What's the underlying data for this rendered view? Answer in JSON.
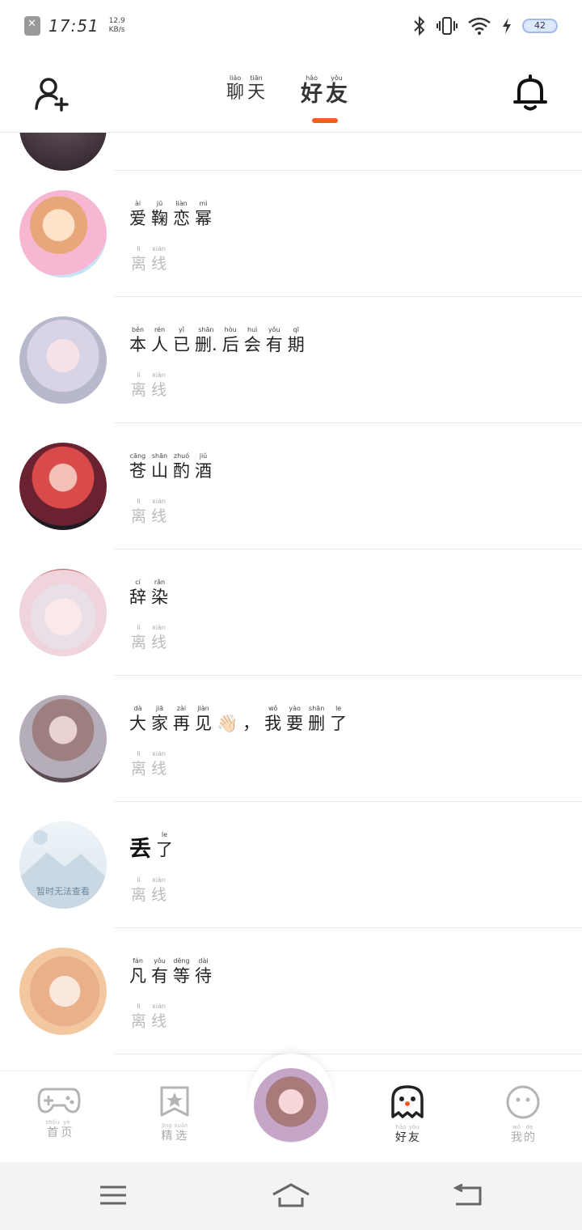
{
  "status_bar": {
    "time": "17:51",
    "speed_value": "12.9",
    "speed_unit": "KB/s",
    "battery": "42"
  },
  "header": {
    "tabs": [
      {
        "label": "聊天",
        "chars": [
          {
            "py": "liáo",
            "hz": "聊"
          },
          {
            "py": "tiān",
            "hz": "天"
          }
        ],
        "active": false
      },
      {
        "label": "好友",
        "chars": [
          {
            "py": "hǎo",
            "hz": "好"
          },
          {
            "py": "yǒu",
            "hz": "友"
          }
        ],
        "active": true
      }
    ]
  },
  "friends": [
    {
      "name_chars": [
        {
          "py": "ài",
          "hz": "爱"
        },
        {
          "py": "jū",
          "hz": "鞠"
        },
        {
          "py": "liàn",
          "hz": "恋"
        },
        {
          "py": "mì",
          "hz": "幂"
        }
      ],
      "status": {
        "chars": [
          {
            "py": "lí",
            "hz": "离"
          },
          {
            "py": "xiàn",
            "hz": "线"
          }
        ]
      }
    },
    {
      "name_chars": [
        {
          "py": "běn",
          "hz": "本"
        },
        {
          "py": "rén",
          "hz": "人"
        },
        {
          "py": "yǐ",
          "hz": "已"
        },
        {
          "py": "shān",
          "hz": "删."
        },
        {
          "py": "hòu",
          "hz": "后"
        },
        {
          "py": "huì",
          "hz": "会"
        },
        {
          "py": "yǒu",
          "hz": "有"
        },
        {
          "py": "qī",
          "hz": "期"
        }
      ],
      "status": {
        "chars": [
          {
            "py": "lí",
            "hz": "离"
          },
          {
            "py": "xiàn",
            "hz": "线"
          }
        ]
      }
    },
    {
      "name_chars": [
        {
          "py": "cāng",
          "hz": "苍"
        },
        {
          "py": "shān",
          "hz": "山"
        },
        {
          "py": "zhuó",
          "hz": "酌"
        },
        {
          "py": "jiǔ",
          "hz": "酒"
        }
      ],
      "status": {
        "chars": [
          {
            "py": "lí",
            "hz": "离"
          },
          {
            "py": "xiàn",
            "hz": "线"
          }
        ]
      }
    },
    {
      "name_chars": [
        {
          "py": "cí",
          "hz": "辞"
        },
        {
          "py": "rǎn",
          "hz": "染"
        }
      ],
      "status": {
        "chars": [
          {
            "py": "lí",
            "hz": "离"
          },
          {
            "py": "xiàn",
            "hz": "线"
          }
        ]
      }
    },
    {
      "name_chars": [
        {
          "py": "dà",
          "hz": "大"
        },
        {
          "py": "jiā",
          "hz": "家"
        },
        {
          "py": "zài",
          "hz": "再"
        },
        {
          "py": "jiàn",
          "hz": "见"
        },
        {
          "py": "",
          "hz": "👋🏻"
        },
        {
          "py": "",
          "hz": "，"
        },
        {
          "py": "wǒ",
          "hz": "我"
        },
        {
          "py": "yào",
          "hz": "要"
        },
        {
          "py": "shān",
          "hz": "删"
        },
        {
          "py": "le",
          "hz": "了"
        }
      ],
      "status": {
        "chars": [
          {
            "py": "lí",
            "hz": "离"
          },
          {
            "py": "xiàn",
            "hz": "线"
          }
        ]
      }
    },
    {
      "name_chars": [
        {
          "py": "",
          "hz": "丢"
        },
        {
          "py": "le",
          "hz": "了"
        }
      ],
      "status": {
        "chars": [
          {
            "py": "lí",
            "hz": "离"
          },
          {
            "py": "xiàn",
            "hz": "线"
          }
        ]
      },
      "avatar_text": "暂时无法查看"
    },
    {
      "name_chars": [
        {
          "py": "fán",
          "hz": "凡"
        },
        {
          "py": "yǒu",
          "hz": "有"
        },
        {
          "py": "děng",
          "hz": "等"
        },
        {
          "py": "dài",
          "hz": "待"
        }
      ],
      "status": {
        "chars": [
          {
            "py": "lí",
            "hz": "离"
          },
          {
            "py": "xiàn",
            "hz": "线"
          }
        ]
      }
    }
  ],
  "bottom_nav": [
    {
      "label": "首页",
      "chars": [
        {
          "py": "shǒu",
          "hz": "首"
        },
        {
          "py": "yè",
          "hz": "页"
        }
      ],
      "icon": "gamepad-icon"
    },
    {
      "label": "精选",
      "chars": [
        {
          "py": "jīng",
          "hz": "精"
        },
        {
          "py": "xuǎn",
          "hz": "选"
        }
      ],
      "icon": "star-bookmark-icon"
    },
    {
      "label": "好友",
      "chars": [
        {
          "py": "hǎo",
          "hz": "好"
        },
        {
          "py": "yǒu",
          "hz": "友"
        }
      ],
      "icon": "ghost-icon",
      "active": true
    },
    {
      "label": "我的",
      "chars": [
        {
          "py": "wǒ",
          "hz": "我"
        },
        {
          "py": "de",
          "hz": "的"
        }
      ],
      "icon": "face-icon"
    }
  ],
  "colors": {
    "accent": "#ff5a1f",
    "separator": "#e8e8e8",
    "muted": "#bbbbbb"
  }
}
